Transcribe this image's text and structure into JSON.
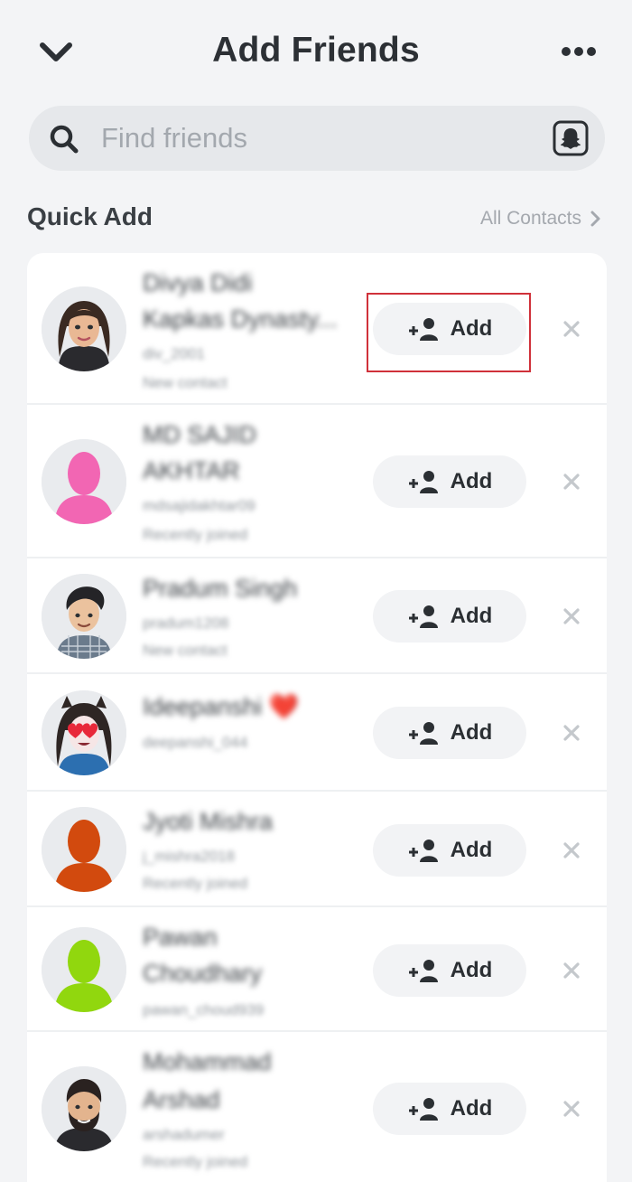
{
  "header": {
    "title": "Add Friends",
    "back_icon": "chevron-down-icon",
    "more_icon": "more-horizontal-icon"
  },
  "search": {
    "placeholder": "Find friends",
    "value": "",
    "icon": "search-icon",
    "snapcode_icon": "snapcode-ghost-icon"
  },
  "quick_add": {
    "title": "Quick Add",
    "all_contacts_label": "All Contacts",
    "add_label": "Add",
    "suggestions": [
      {
        "name_lines": [
          "Divya Didi",
          "Kapkas Dynasty..."
        ],
        "sub_lines": [
          "div_2001",
          "New contact"
        ]
      },
      {
        "name_lines": [
          "MD SAJID",
          "AKHTAR"
        ],
        "sub_lines": [
          "mdsajidakhtar09",
          "Recently joined"
        ]
      },
      {
        "name_lines": [
          "Pradum Singh"
        ],
        "sub_lines": [
          "pradum1208",
          "New contact"
        ]
      },
      {
        "name_lines": [
          "Ideepanshi ❤️"
        ],
        "sub_lines": [
          "deepanshi_044"
        ]
      },
      {
        "name_lines": [
          "Jyoti Mishra"
        ],
        "sub_lines": [
          "j_mishra2018",
          "Recently joined"
        ]
      },
      {
        "name_lines": [
          "Pawan",
          "Choudhary"
        ],
        "sub_lines": [
          "pawan_choud939"
        ]
      },
      {
        "name_lines": [
          "Mohammad",
          "Arshad"
        ],
        "sub_lines": [
          "arshadumer",
          "Recently joined"
        ]
      }
    ]
  },
  "colors": {
    "background": "#F3F4F6",
    "card": "#FFFFFF",
    "highlight_border": "#D0313A",
    "silhouette_pink": "#F266B3",
    "silhouette_orange": "#D24A0E",
    "silhouette_green": "#91D70E"
  }
}
